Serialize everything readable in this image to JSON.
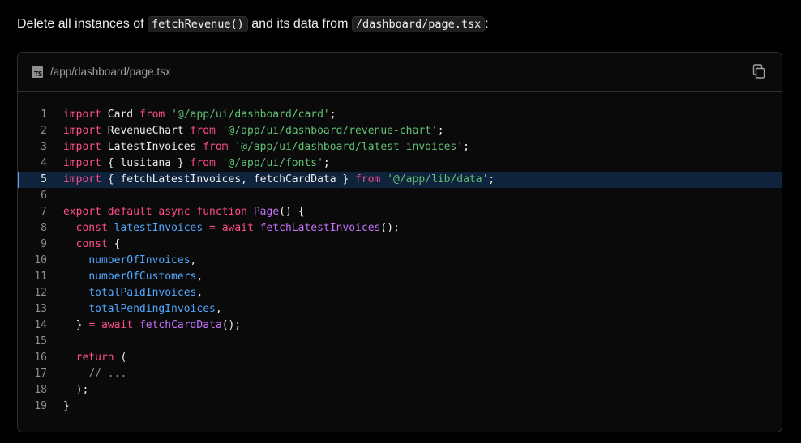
{
  "instruction": {
    "prefix": "Delete all instances of ",
    "code1": "fetchRevenue()",
    "middle": " and its data from ",
    "code2": "/dashboard/page.tsx",
    "suffix": ":"
  },
  "code_block": {
    "file_icon": "typescript-file-icon",
    "file_icon_text": "TS",
    "file_path": "/app/dashboard/page.tsx",
    "copy_icon": "copy-icon",
    "highlighted_line": 5,
    "lines": [
      [
        [
          "kw",
          "import"
        ],
        [
          "pl",
          " Card "
        ],
        [
          "kw",
          "from"
        ],
        [
          "pl",
          " "
        ],
        [
          "str",
          "'@/app/ui/dashboard/card'"
        ],
        [
          "pl",
          ";"
        ]
      ],
      [
        [
          "kw",
          "import"
        ],
        [
          "pl",
          " RevenueChart "
        ],
        [
          "kw",
          "from"
        ],
        [
          "pl",
          " "
        ],
        [
          "str",
          "'@/app/ui/dashboard/revenue-chart'"
        ],
        [
          "pl",
          ";"
        ]
      ],
      [
        [
          "kw",
          "import"
        ],
        [
          "pl",
          " LatestInvoices "
        ],
        [
          "kw",
          "from"
        ],
        [
          "pl",
          " "
        ],
        [
          "str",
          "'@/app/ui/dashboard/latest-invoices'"
        ],
        [
          "pl",
          ";"
        ]
      ],
      [
        [
          "kw",
          "import"
        ],
        [
          "pl",
          " { lusitana } "
        ],
        [
          "kw",
          "from"
        ],
        [
          "pl",
          " "
        ],
        [
          "str",
          "'@/app/ui/fonts'"
        ],
        [
          "pl",
          ";"
        ]
      ],
      [
        [
          "kw",
          "import"
        ],
        [
          "pl",
          " { fetchLatestInvoices, fetchCardData } "
        ],
        [
          "kw",
          "from"
        ],
        [
          "pl",
          " "
        ],
        [
          "str",
          "'@/app/lib/data'"
        ],
        [
          "pl",
          ";"
        ]
      ],
      [],
      [
        [
          "kw",
          "export"
        ],
        [
          "pl",
          " "
        ],
        [
          "kw",
          "default"
        ],
        [
          "pl",
          " "
        ],
        [
          "kw",
          "async"
        ],
        [
          "pl",
          " "
        ],
        [
          "kw",
          "function"
        ],
        [
          "pl",
          " "
        ],
        [
          "fn",
          "Page"
        ],
        [
          "pl",
          "() {"
        ]
      ],
      [
        [
          "pl",
          "  "
        ],
        [
          "kw",
          "const"
        ],
        [
          "pl",
          " "
        ],
        [
          "var",
          "latestInvoices"
        ],
        [
          "pl",
          " "
        ],
        [
          "kw",
          "="
        ],
        [
          "pl",
          " "
        ],
        [
          "kw",
          "await"
        ],
        [
          "pl",
          " "
        ],
        [
          "fn",
          "fetchLatestInvoices"
        ],
        [
          "pl",
          "();"
        ]
      ],
      [
        [
          "pl",
          "  "
        ],
        [
          "kw",
          "const"
        ],
        [
          "pl",
          " {"
        ]
      ],
      [
        [
          "pl",
          "    "
        ],
        [
          "var",
          "numberOfInvoices"
        ],
        [
          "pl",
          ","
        ]
      ],
      [
        [
          "pl",
          "    "
        ],
        [
          "var",
          "numberOfCustomers"
        ],
        [
          "pl",
          ","
        ]
      ],
      [
        [
          "pl",
          "    "
        ],
        [
          "var",
          "totalPaidInvoices"
        ],
        [
          "pl",
          ","
        ]
      ],
      [
        [
          "pl",
          "    "
        ],
        [
          "var",
          "totalPendingInvoices"
        ],
        [
          "pl",
          ","
        ]
      ],
      [
        [
          "pl",
          "  } "
        ],
        [
          "kw",
          "="
        ],
        [
          "pl",
          " "
        ],
        [
          "kw",
          "await"
        ],
        [
          "pl",
          " "
        ],
        [
          "fn",
          "fetchCardData"
        ],
        [
          "pl",
          "();"
        ]
      ],
      [],
      [
        [
          "pl",
          "  "
        ],
        [
          "kw",
          "return"
        ],
        [
          "pl",
          " ("
        ]
      ],
      [
        [
          "pl",
          "    "
        ],
        [
          "cm",
          "// ..."
        ]
      ],
      [
        [
          "pl",
          "  );"
        ]
      ],
      [
        [
          "pl",
          "}"
        ]
      ]
    ]
  }
}
